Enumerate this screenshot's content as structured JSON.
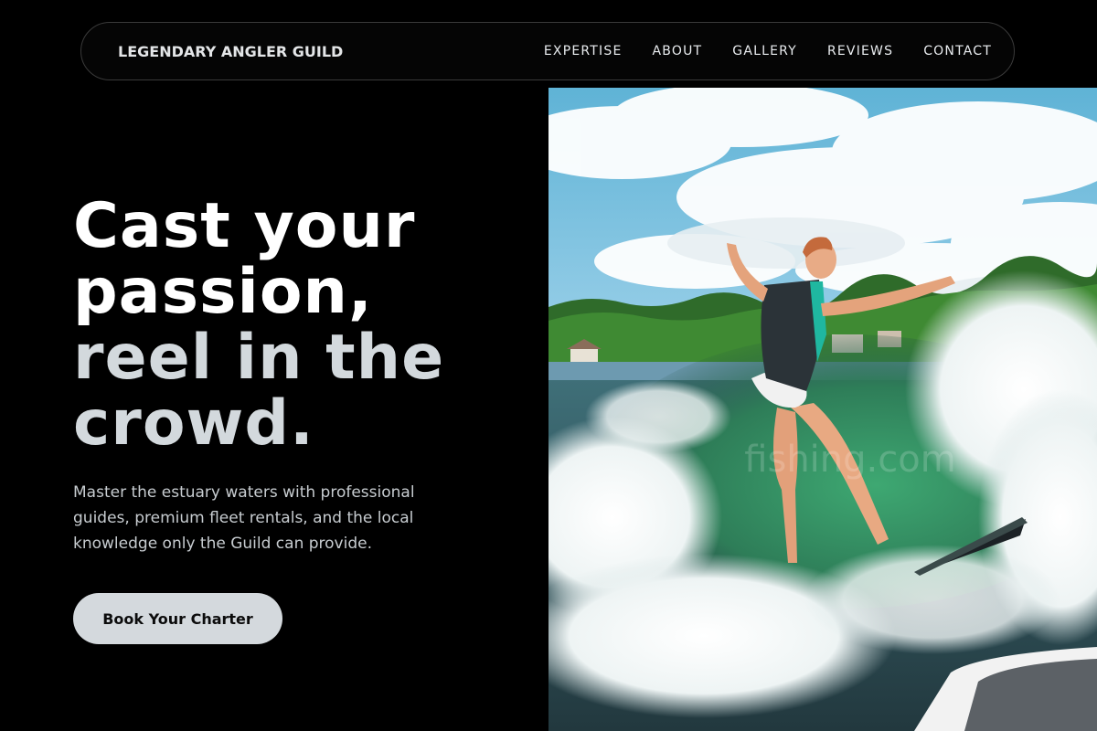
{
  "nav": {
    "brand": "LEGENDARY ANGLER GUILD",
    "links": [
      {
        "label": "EXPERTISE"
      },
      {
        "label": "ABOUT"
      },
      {
        "label": "GALLERY"
      },
      {
        "label": "REVIEWS"
      },
      {
        "label": "CONTACT"
      }
    ]
  },
  "hero": {
    "title_lines": [
      "Cast your",
      "passion,",
      "reel in the",
      "crowd."
    ],
    "subtitle": "Master the estuary waters with professional guides, premium fleet rentals, and the local knowledge only the Guild can provide.",
    "cta_label": "Book Your Charter",
    "image_watermark": "fishing.com"
  },
  "colors": {
    "background": "#000000",
    "title_primary": "#ffffff",
    "title_secondary": "#d3d9dd",
    "cta_background": "#d4d9dd",
    "nav_border": "#3a3a3a"
  }
}
